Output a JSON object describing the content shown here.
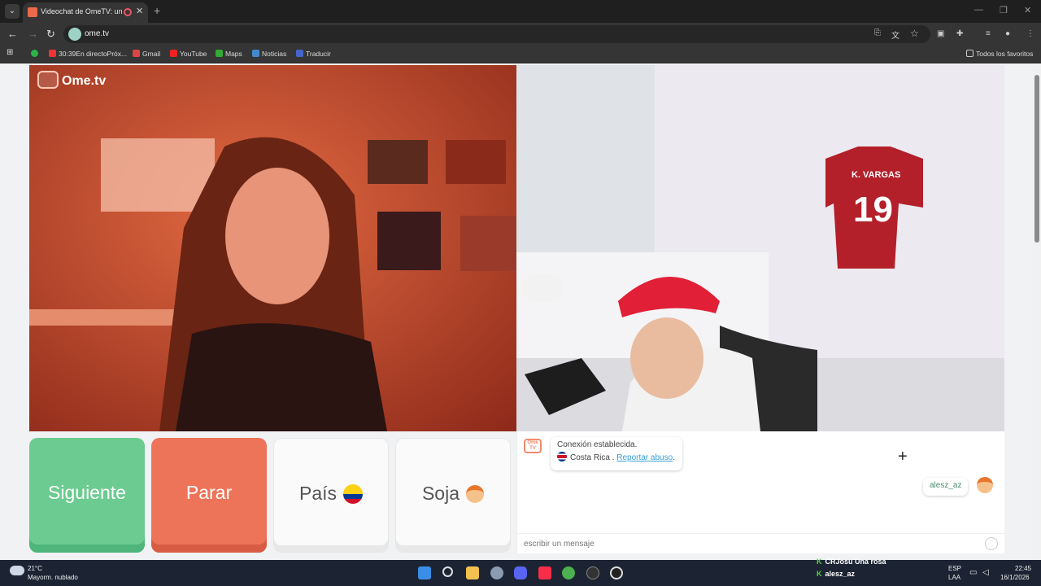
{
  "browser": {
    "tab_title": "Videochat de OmeTV: una",
    "new_tab": "+",
    "url": "ome.tv",
    "bookmarks": [
      {
        "label": "30:39En directoPróx...",
        "color": "#e33"
      },
      {
        "label": "Gmail",
        "color": "#d44"
      },
      {
        "label": "YouTube",
        "color": "#e22"
      },
      {
        "label": "Maps",
        "color": "#3a3"
      },
      {
        "label": "Noticias",
        "color": "#48c"
      },
      {
        "label": "Traducir",
        "color": "#46c"
      }
    ],
    "all_bookmarks": "Todos los favoritos"
  },
  "page": {
    "logo_text": "Ome.tv",
    "buttons": {
      "next": "Siguiente",
      "stop": "Parar",
      "country": "País",
      "gender": "Soja"
    },
    "chat": {
      "connection": "Conexión establecida.",
      "country": "Costa Rica .",
      "report": "Reportar abuso",
      "period": ".",
      "username": "alesz_az",
      "placeholder": "escribir un mensaje"
    },
    "remote_video": {
      "label": "stranger video"
    },
    "local_video": {
      "jersey": "K. VARGAS",
      "jersey_number": "19"
    }
  },
  "taskbar": {
    "temperature": "21°C",
    "weather": "Mayorm. nublado",
    "stream_lines": [
      "CRJosu  Una rosa",
      "alesz_az"
    ],
    "lang": "ESP",
    "lang2": "LAA",
    "time": "22:45",
    "date": "16/1/2026"
  }
}
